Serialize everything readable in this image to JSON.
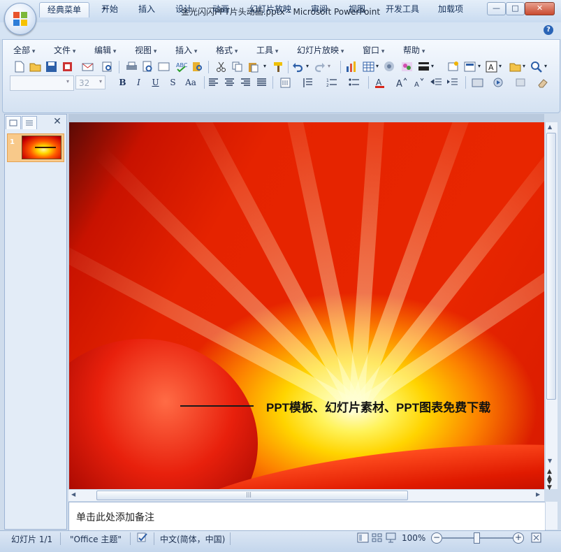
{
  "window": {
    "title": "金光闪闪PPT片头动画.pptx - Microsoft PowerPoint",
    "buttons": {
      "minimize": "—",
      "maximize": "□",
      "close": "✕"
    }
  },
  "ribbon": {
    "tabs": [
      "经典菜单",
      "开始",
      "插入",
      "设计",
      "动画",
      "幻灯片放映",
      "审阅",
      "视图",
      "开发工具",
      "加载项"
    ],
    "active_tab": "经典菜单",
    "menus": [
      "全部",
      "文件",
      "编辑",
      "视图",
      "插入",
      "格式",
      "工具",
      "幻灯片放映",
      "窗口",
      "帮助"
    ],
    "font_size": "32",
    "format_buttons": [
      "B",
      "I",
      "U",
      "S",
      "Aa"
    ]
  },
  "slides_panel": {
    "slide_number": "1"
  },
  "slide": {
    "headline": "PPT模板、幻灯片素材、PPT图表免费下载"
  },
  "notes": {
    "placeholder": "单击此处添加备注"
  },
  "statusbar": {
    "slide_info": "幻灯片 1/1",
    "theme": "\"Office 主题\"",
    "language": "中文(简体，中国)",
    "zoom": "100%"
  },
  "colors": {
    "accent": "#2a64b6",
    "slide_red": "#e52300",
    "slide_gold": "#ffd400"
  }
}
